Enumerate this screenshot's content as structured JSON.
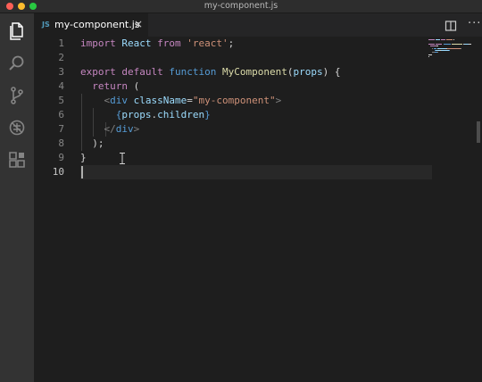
{
  "window": {
    "title": "my-component.js"
  },
  "activity_bar": {
    "icons": [
      "files-icon",
      "search-icon",
      "source-control-icon",
      "debug-icon",
      "extensions-icon"
    ]
  },
  "tabs": [
    {
      "lang_badge": "JS",
      "label": "my-component.js",
      "close": "×"
    }
  ],
  "editor_actions": {
    "more": "···"
  },
  "editor": {
    "line_numbers": [
      "1",
      "2",
      "3",
      "4",
      "5",
      "6",
      "7",
      "8",
      "9",
      "10"
    ],
    "lines": [
      {
        "tokens": [
          {
            "cls": "kw",
            "text": "import"
          },
          {
            "cls": "pl",
            "text": " "
          },
          {
            "cls": "va",
            "text": "React"
          },
          {
            "cls": "pl",
            "text": " "
          },
          {
            "cls": "kw",
            "text": "from"
          },
          {
            "cls": "pl",
            "text": " "
          },
          {
            "cls": "str",
            "text": "'react'"
          },
          {
            "cls": "pl",
            "text": ";"
          }
        ]
      },
      {
        "tokens": []
      },
      {
        "tokens": [
          {
            "cls": "kw",
            "text": "export"
          },
          {
            "cls": "pl",
            "text": " "
          },
          {
            "cls": "kw",
            "text": "default"
          },
          {
            "cls": "pl",
            "text": " "
          },
          {
            "cls": "st",
            "text": "function"
          },
          {
            "cls": "pl",
            "text": " "
          },
          {
            "cls": "fn",
            "text": "MyComponent"
          },
          {
            "cls": "pl",
            "text": "("
          },
          {
            "cls": "va",
            "text": "props"
          },
          {
            "cls": "pl",
            "text": ") {"
          }
        ]
      },
      {
        "tokens": [
          {
            "cls": "pl",
            "text": "  "
          },
          {
            "cls": "kw",
            "text": "return"
          },
          {
            "cls": "pl",
            "text": " ("
          }
        ]
      },
      {
        "tokens": [
          {
            "cls": "pl",
            "text": "    "
          },
          {
            "cls": "br",
            "text": "<"
          },
          {
            "cls": "tg",
            "text": "div"
          },
          {
            "cls": "pl",
            "text": " "
          },
          {
            "cls": "va",
            "text": "className"
          },
          {
            "cls": "pl",
            "text": "="
          },
          {
            "cls": "str",
            "text": "\"my-component\""
          },
          {
            "cls": "br",
            "text": ">"
          }
        ]
      },
      {
        "tokens": [
          {
            "cls": "pl",
            "text": "      "
          },
          {
            "cls": "st",
            "text": "{"
          },
          {
            "cls": "va",
            "text": "props"
          },
          {
            "cls": "pl",
            "text": "."
          },
          {
            "cls": "va",
            "text": "children"
          },
          {
            "cls": "st",
            "text": "}"
          }
        ]
      },
      {
        "tokens": [
          {
            "cls": "pl",
            "text": "    "
          },
          {
            "cls": "br",
            "text": "</"
          },
          {
            "cls": "tg",
            "text": "div"
          },
          {
            "cls": "br",
            "text": ">"
          }
        ]
      },
      {
        "tokens": [
          {
            "cls": "pl",
            "text": "  );"
          }
        ]
      },
      {
        "tokens": [
          {
            "cls": "pl",
            "text": "}"
          }
        ]
      },
      {
        "tokens": []
      }
    ],
    "active_line": 10
  },
  "colors": {
    "keyword": "#c586c0",
    "storage": "#569cd6",
    "function": "#dcdcaa",
    "variable": "#9cdcfe",
    "string": "#ce9178",
    "activity_bar": "#333333",
    "editor_bg": "#1e1e1e"
  }
}
